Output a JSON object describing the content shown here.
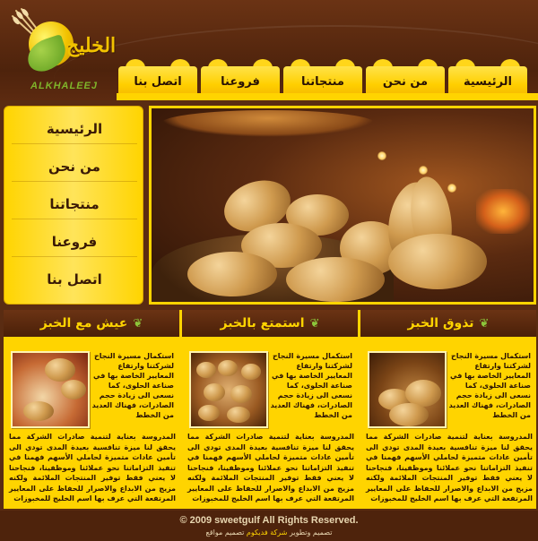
{
  "brand": {
    "name_ar": "الخليج",
    "name_en": "ALKHALEEJ"
  },
  "nav": {
    "items": [
      {
        "label": "الرئيسية"
      },
      {
        "label": "من نحن"
      },
      {
        "label": "منتجاتنا"
      },
      {
        "label": "فروعنا"
      },
      {
        "label": "اتصل بنا"
      }
    ]
  },
  "sidebar": {
    "items": [
      {
        "label": "الرئيسية"
      },
      {
        "label": "من نحن"
      },
      {
        "label": "منتجاتنا"
      },
      {
        "label": "فروعنا"
      },
      {
        "label": "اتصل بنا"
      }
    ]
  },
  "columns": [
    {
      "title": "تذوق الخبز",
      "short": "استكمال مسيرة النجاح لشركتنا وارتفاع المعايير الخاصة بها في صناعة الحلوى، كما نسعى الى زيادة حجم الصادرات، فهناك العديد من الخطط",
      "long": "المدروسة بعناية لتنمية صادرات الشركة مما يحقق لنا ميزة تنافسية بعيدة المدى تودي الى تأمين عادات متميزة لحاملي الأسهم فهمنا في تنفيذ التزاماتنا نحو عملائنا وموظفينا، فنجاحنا لا يعني فقط توفير المنتجات الملائمة ولكنه مزيج من الابداع والاصرار للحفاظ على المعايير المرتفعة التي عرف بها اسم الخليج للمخبوزات"
    },
    {
      "title": "استمتع بالخبز",
      "short": "استكمال مسيرة النجاح لشركتنا وارتفاع المعايير الخاصة بها في صناعة الحلوى، كما نسعى الى زيادة حجم الصادرات، فهناك العديد من الخطط",
      "long": "المدروسة بعناية لتنمية صادرات الشركة مما يحقق لنا ميزة تنافسية بعيدة المدى تودي الى تأمين عادات متميزة لحاملي الأسهم فهمنا في تنفيذ التزاماتنا نحو عملائنا وموظفينا، فنجاحنا لا يعني فقط توفير المنتجات الملائمة ولكنه مزيج من الابداع والاصرار للحفاظ على المعايير المرتفعة التي عرف بها اسم الخليج للمخبوزات"
    },
    {
      "title": "عيش مع الخبز",
      "short": "استكمال مسيرة النجاح لشركتنا وارتفاع المعايير الخاصة بها في صناعة الحلوى، كما نسعى الى زيادة حجم الصادرات، فهناك العديد من الخطط",
      "long": "المدروسة بعناية لتنمية صادرات الشركة مما يحقق لنا ميزة تنافسية بعيدة المدى تودي الى تأمين عادات متميزة لحاملي الأسهم فهمنا في تنفيذ التزاماتنا نحو عملائنا وموظفينا، فنجاحنا لا يعني فقط توفير المنتجات الملائمة ولكنه مزيج من الابداع والاصرار للحفاظ على المعايير المرتفعة التي عرف بها اسم الخليج للمخبوزات"
    }
  ],
  "footer": {
    "copyright": "© 2009 sweetgulf All Rights Reserved.",
    "design_prefix": "تصميم وتطوير",
    "design_company": "شركة فديكوم",
    "design_suffix": "تصميم مواقع"
  },
  "colors": {
    "brown": "#4e230c",
    "yellow": "#ffd400",
    "green": "#7fb52a"
  }
}
